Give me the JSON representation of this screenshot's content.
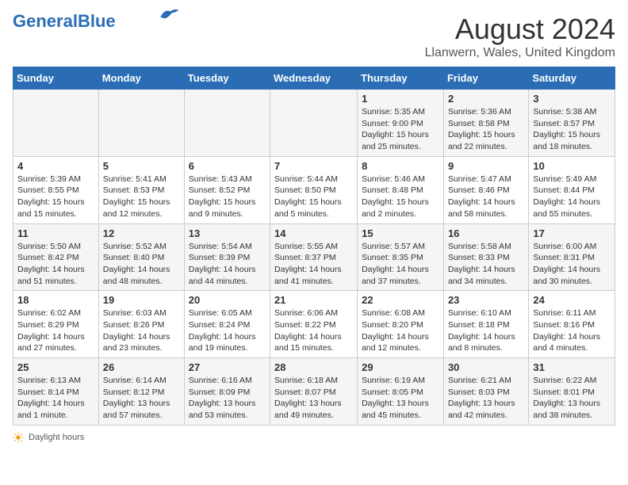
{
  "header": {
    "logo_general": "General",
    "logo_blue": "Blue",
    "month": "August 2024",
    "location": "Llanwern, Wales, United Kingdom"
  },
  "days_of_week": [
    "Sunday",
    "Monday",
    "Tuesday",
    "Wednesday",
    "Thursday",
    "Friday",
    "Saturday"
  ],
  "weeks": [
    [
      {
        "day": "",
        "info": ""
      },
      {
        "day": "",
        "info": ""
      },
      {
        "day": "",
        "info": ""
      },
      {
        "day": "",
        "info": ""
      },
      {
        "day": "1",
        "info": "Sunrise: 5:35 AM\nSunset: 9:00 PM\nDaylight: 15 hours\nand 25 minutes."
      },
      {
        "day": "2",
        "info": "Sunrise: 5:36 AM\nSunset: 8:58 PM\nDaylight: 15 hours\nand 22 minutes."
      },
      {
        "day": "3",
        "info": "Sunrise: 5:38 AM\nSunset: 8:57 PM\nDaylight: 15 hours\nand 18 minutes."
      }
    ],
    [
      {
        "day": "4",
        "info": "Sunrise: 5:39 AM\nSunset: 8:55 PM\nDaylight: 15 hours\nand 15 minutes."
      },
      {
        "day": "5",
        "info": "Sunrise: 5:41 AM\nSunset: 8:53 PM\nDaylight: 15 hours\nand 12 minutes."
      },
      {
        "day": "6",
        "info": "Sunrise: 5:43 AM\nSunset: 8:52 PM\nDaylight: 15 hours\nand 9 minutes."
      },
      {
        "day": "7",
        "info": "Sunrise: 5:44 AM\nSunset: 8:50 PM\nDaylight: 15 hours\nand 5 minutes."
      },
      {
        "day": "8",
        "info": "Sunrise: 5:46 AM\nSunset: 8:48 PM\nDaylight: 15 hours\nand 2 minutes."
      },
      {
        "day": "9",
        "info": "Sunrise: 5:47 AM\nSunset: 8:46 PM\nDaylight: 14 hours\nand 58 minutes."
      },
      {
        "day": "10",
        "info": "Sunrise: 5:49 AM\nSunset: 8:44 PM\nDaylight: 14 hours\nand 55 minutes."
      }
    ],
    [
      {
        "day": "11",
        "info": "Sunrise: 5:50 AM\nSunset: 8:42 PM\nDaylight: 14 hours\nand 51 minutes."
      },
      {
        "day": "12",
        "info": "Sunrise: 5:52 AM\nSunset: 8:40 PM\nDaylight: 14 hours\nand 48 minutes."
      },
      {
        "day": "13",
        "info": "Sunrise: 5:54 AM\nSunset: 8:39 PM\nDaylight: 14 hours\nand 44 minutes."
      },
      {
        "day": "14",
        "info": "Sunrise: 5:55 AM\nSunset: 8:37 PM\nDaylight: 14 hours\nand 41 minutes."
      },
      {
        "day": "15",
        "info": "Sunrise: 5:57 AM\nSunset: 8:35 PM\nDaylight: 14 hours\nand 37 minutes."
      },
      {
        "day": "16",
        "info": "Sunrise: 5:58 AM\nSunset: 8:33 PM\nDaylight: 14 hours\nand 34 minutes."
      },
      {
        "day": "17",
        "info": "Sunrise: 6:00 AM\nSunset: 8:31 PM\nDaylight: 14 hours\nand 30 minutes."
      }
    ],
    [
      {
        "day": "18",
        "info": "Sunrise: 6:02 AM\nSunset: 8:29 PM\nDaylight: 14 hours\nand 27 minutes."
      },
      {
        "day": "19",
        "info": "Sunrise: 6:03 AM\nSunset: 8:26 PM\nDaylight: 14 hours\nand 23 minutes."
      },
      {
        "day": "20",
        "info": "Sunrise: 6:05 AM\nSunset: 8:24 PM\nDaylight: 14 hours\nand 19 minutes."
      },
      {
        "day": "21",
        "info": "Sunrise: 6:06 AM\nSunset: 8:22 PM\nDaylight: 14 hours\nand 15 minutes."
      },
      {
        "day": "22",
        "info": "Sunrise: 6:08 AM\nSunset: 8:20 PM\nDaylight: 14 hours\nand 12 minutes."
      },
      {
        "day": "23",
        "info": "Sunrise: 6:10 AM\nSunset: 8:18 PM\nDaylight: 14 hours\nand 8 minutes."
      },
      {
        "day": "24",
        "info": "Sunrise: 6:11 AM\nSunset: 8:16 PM\nDaylight: 14 hours\nand 4 minutes."
      }
    ],
    [
      {
        "day": "25",
        "info": "Sunrise: 6:13 AM\nSunset: 8:14 PM\nDaylight: 14 hours\nand 1 minute."
      },
      {
        "day": "26",
        "info": "Sunrise: 6:14 AM\nSunset: 8:12 PM\nDaylight: 13 hours\nand 57 minutes."
      },
      {
        "day": "27",
        "info": "Sunrise: 6:16 AM\nSunset: 8:09 PM\nDaylight: 13 hours\nand 53 minutes."
      },
      {
        "day": "28",
        "info": "Sunrise: 6:18 AM\nSunset: 8:07 PM\nDaylight: 13 hours\nand 49 minutes."
      },
      {
        "day": "29",
        "info": "Sunrise: 6:19 AM\nSunset: 8:05 PM\nDaylight: 13 hours\nand 45 minutes."
      },
      {
        "day": "30",
        "info": "Sunrise: 6:21 AM\nSunset: 8:03 PM\nDaylight: 13 hours\nand 42 minutes."
      },
      {
        "day": "31",
        "info": "Sunrise: 6:22 AM\nSunset: 8:01 PM\nDaylight: 13 hours\nand 38 minutes."
      }
    ]
  ],
  "footer": {
    "daylight_label": "Daylight hours"
  }
}
